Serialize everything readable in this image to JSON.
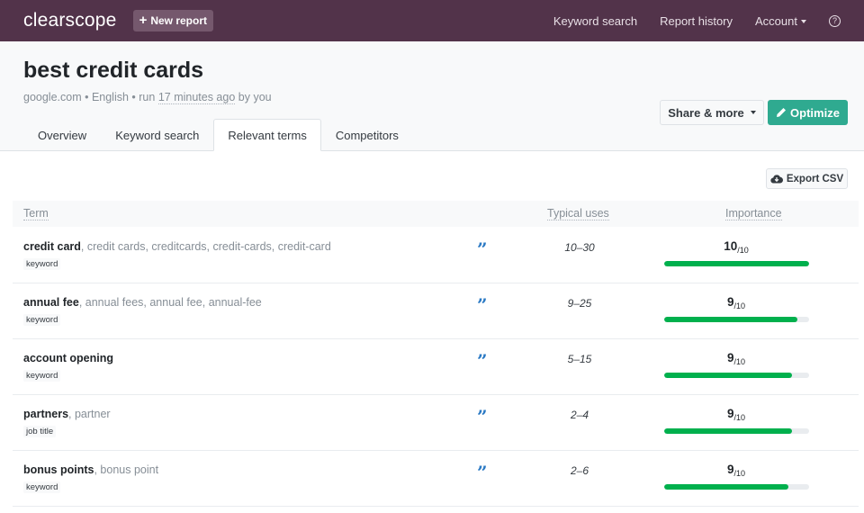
{
  "topbar": {
    "logo": "clearscope",
    "new_report": "New report",
    "nav": [
      "Keyword search",
      "Report history",
      "Account"
    ],
    "help_icon": "?"
  },
  "header": {
    "title": "best credit cards",
    "meta_prefix": "google.com • English • run ",
    "meta_ago": "17 minutes ago",
    "meta_suffix": " by you",
    "share_label": "Share & more",
    "optimize_label": "Optimize",
    "tabs": [
      {
        "label": "Overview",
        "active": false
      },
      {
        "label": "Keyword search",
        "active": false
      },
      {
        "label": "Relevant terms",
        "active": true
      },
      {
        "label": "Competitors",
        "active": false
      }
    ]
  },
  "main": {
    "export_label": "Export CSV",
    "columns": {
      "term": "Term",
      "uses": "Typical uses",
      "importance": "Importance"
    },
    "rows": [
      {
        "term": "credit card",
        "variants": ", credit cards, creditcards, credit-cards, credit-card",
        "tag": "keyword",
        "uses": "10–30",
        "importance": "10",
        "max": "/10",
        "fill": 1.0
      },
      {
        "term": "annual fee",
        "variants": ", annual fees, annual fee, annual-fee",
        "tag": "keyword",
        "uses": "9–25",
        "importance": "9",
        "max": "/10",
        "fill": 0.92
      },
      {
        "term": "account opening",
        "variants": "",
        "tag": "keyword",
        "uses": "5–15",
        "importance": "9",
        "max": "/10",
        "fill": 0.88
      },
      {
        "term": "partners",
        "variants": ", partner",
        "tag": "job title",
        "uses": "2–4",
        "importance": "9",
        "max": "/10",
        "fill": 0.88
      },
      {
        "term": "bonus points",
        "variants": ", bonus point",
        "tag": "keyword",
        "uses": "2–6",
        "importance": "9",
        "max": "/10",
        "fill": 0.86
      }
    ],
    "quote_icon": "”"
  },
  "colors": {
    "topbar": "#52334a",
    "optimize": "#2faa90",
    "bar_fill": "#00b04d",
    "quote": "#2a79c4"
  }
}
